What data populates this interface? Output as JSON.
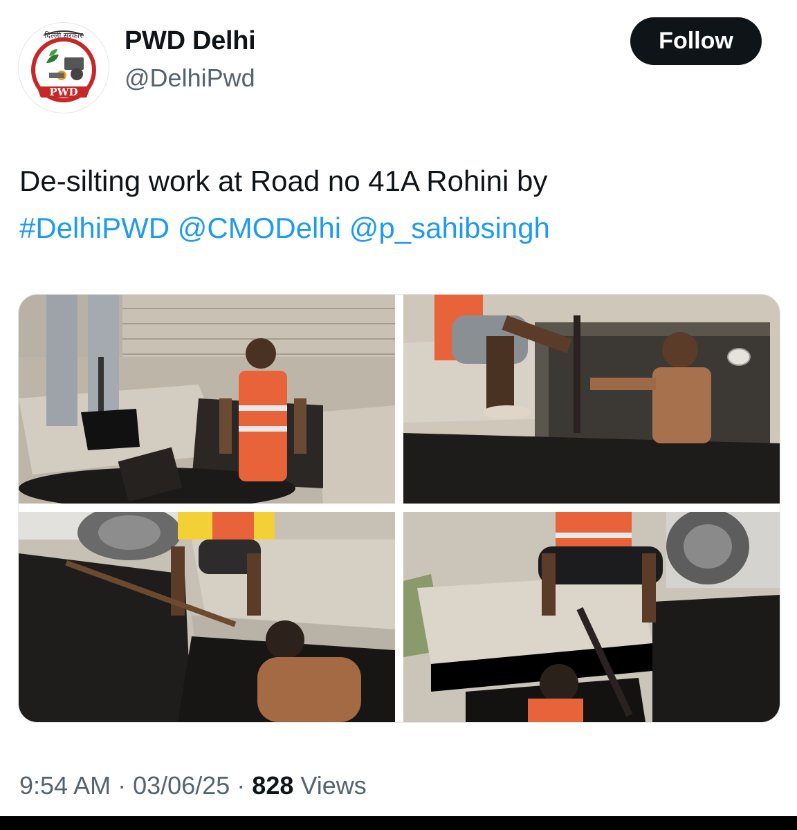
{
  "account": {
    "display_name": "PWD Delhi",
    "handle": "@DelhiPwd",
    "avatar_logo_text": "PWD",
    "avatar_top_text": "दिल्ली सरकार"
  },
  "follow_button": {
    "label": "Follow"
  },
  "tweet": {
    "text_plain": "De-silting work at Road no 41A Rohini by",
    "hashtag": "#DelhiPWD",
    "mention_1": "@CMODelhi",
    "mention_2": "@p_sahibsingh"
  },
  "media": [
    {
      "name": "photo-1",
      "description_icon": "drain-desilting-photo"
    },
    {
      "name": "photo-2",
      "description_icon": "drain-desilting-photo"
    },
    {
      "name": "photo-3",
      "description_icon": "drain-desilting-photo"
    },
    {
      "name": "photo-4",
      "description_icon": "drain-desilting-photo"
    }
  ],
  "meta": {
    "time": "9:54 AM",
    "separator": "·",
    "date": "03/06/25",
    "views_count": "828",
    "views_label": "Views"
  },
  "colors": {
    "link": "#1d9bf0",
    "text": "#0f1419",
    "secondary": "#536471",
    "button_bg": "#0f1419"
  }
}
